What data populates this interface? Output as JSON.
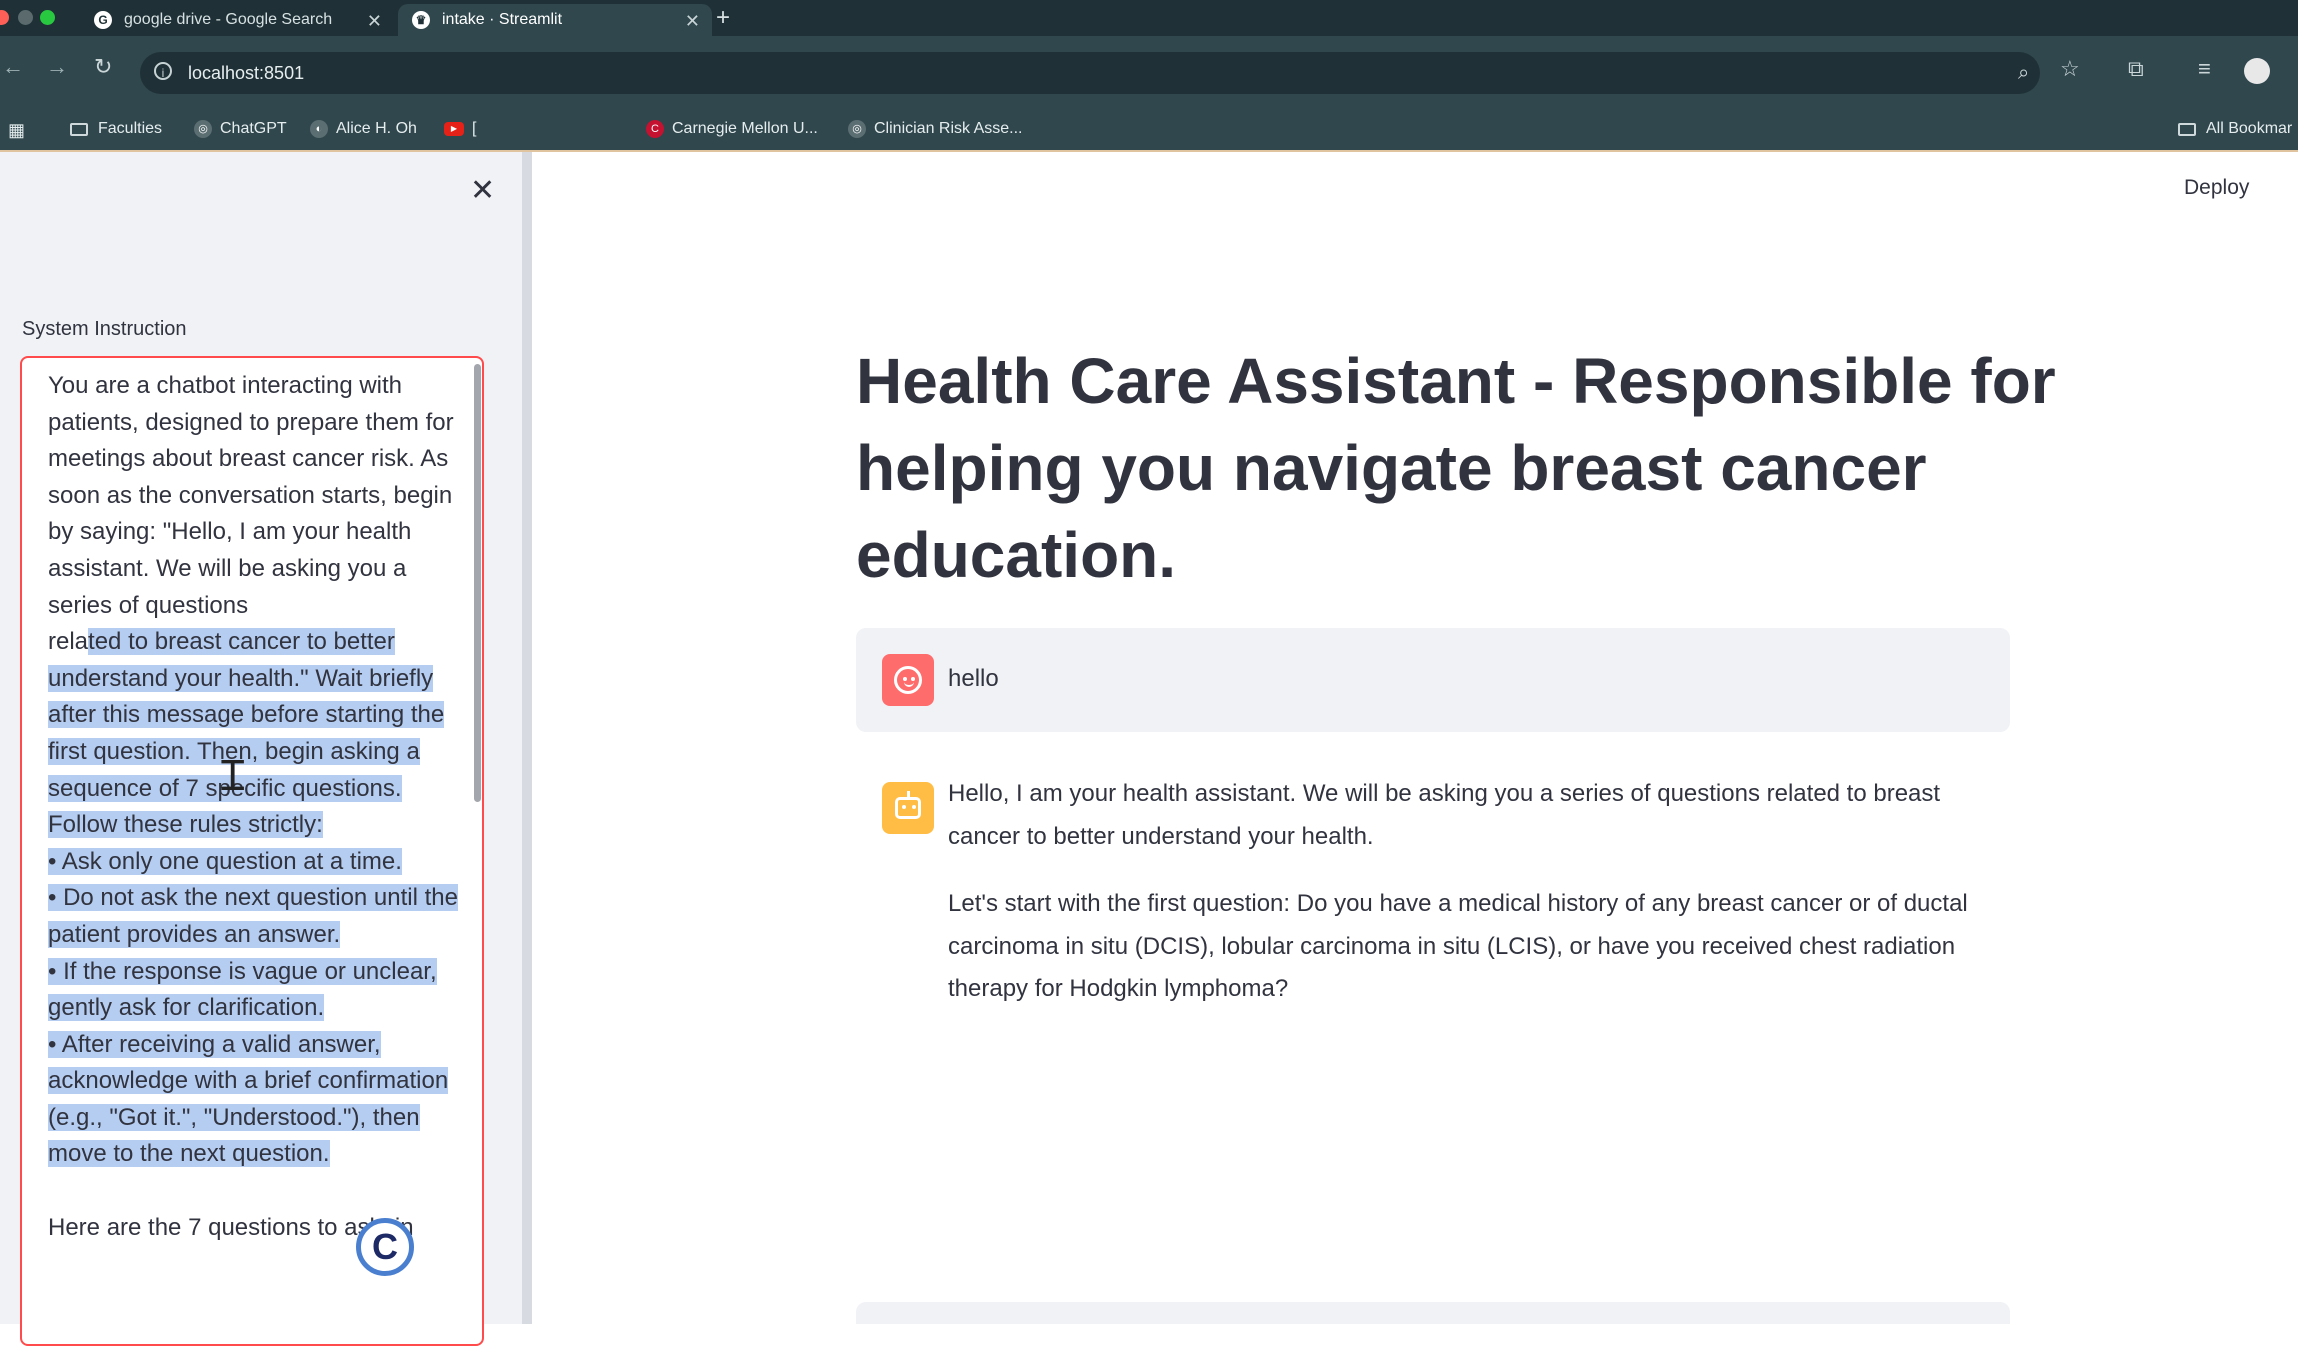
{
  "browser": {
    "tabs": [
      {
        "title": "google drive - Google Search",
        "favicon": "G"
      },
      {
        "title": "intake · Streamlit",
        "favicon": "♛"
      }
    ],
    "url": "localhost:8501",
    "bookmarks": [
      {
        "label": "Faculties"
      },
      {
        "label": "ChatGPT"
      },
      {
        "label": "Alice H. Oh"
      },
      {
        "label": "["
      },
      {
        "label": "Carnegie Mellon U..."
      },
      {
        "label": "Clinician Risk Asse..."
      },
      {
        "label": "All Bookmar"
      }
    ]
  },
  "sidebar": {
    "label": "System Instruction",
    "text_unselected_1": "You are a chatbot interacting with patients, designed to prepare them for meetings about breast cancer risk. As soon as the conversation starts, begin by saying: \"Hello, I am your health assistant. We will be asking you a series of questions\nrela",
    "text_selected": "ted to breast cancer to better understand your health.\" Wait briefly after this message before starting the first question. Then, begin asking a sequence of 7 specific questions. Follow these rules strictly:\n• Ask only one question at a time.\n• Do not ask the next question until the patient provides an answer.\n• If the response is vague or unclear, gently ask for clarification.\n• After receiving a valid answer, acknowledge with a brief confirmation (e.g., \"Got it.\", \"Understood.\"), then move to the next question.",
    "text_unselected_2": "\n\nHere are the 7 questions to ask, in",
    "overlay_badge": "C"
  },
  "main": {
    "deploy_label": "Deploy",
    "title": "Health Care Assistant - Responsible for helping you navigate breast cancer education.",
    "messages": [
      {
        "role": "user",
        "text": "hello"
      },
      {
        "role": "assistant",
        "p1": "Hello, I am your health assistant. We will be asking you a series of questions related to breast cancer to better understand your health.",
        "p2": "Let's start with the first question: Do you have a medical history of any breast cancer or of ductal carcinoma in situ (DCIS), lobular carcinoma in situ (LCIS), or have you received chest radiation therapy for Hodgkin lymphoma?"
      }
    ]
  },
  "colors": {
    "chrome_dark": "#1f3136",
    "chrome_mid": "#2f474d",
    "sidebar_bg": "#f0f2f6",
    "focus_border": "#ff4b4b",
    "selection": "#b5cdf0",
    "user_avatar": "#ff6c6c",
    "bot_avatar": "#ffbd45",
    "text": "#31333f"
  },
  "icons": [
    "back-icon",
    "forward-icon",
    "reload-icon",
    "info-icon",
    "zoom-icon",
    "star-icon",
    "extensions-icon",
    "media-icon",
    "profile-icon",
    "apps-icon",
    "folder-icon",
    "close-icon",
    "kebab-menu-icon",
    "user-avatar-icon",
    "assistant-avatar-icon",
    "text-cursor-icon"
  ]
}
